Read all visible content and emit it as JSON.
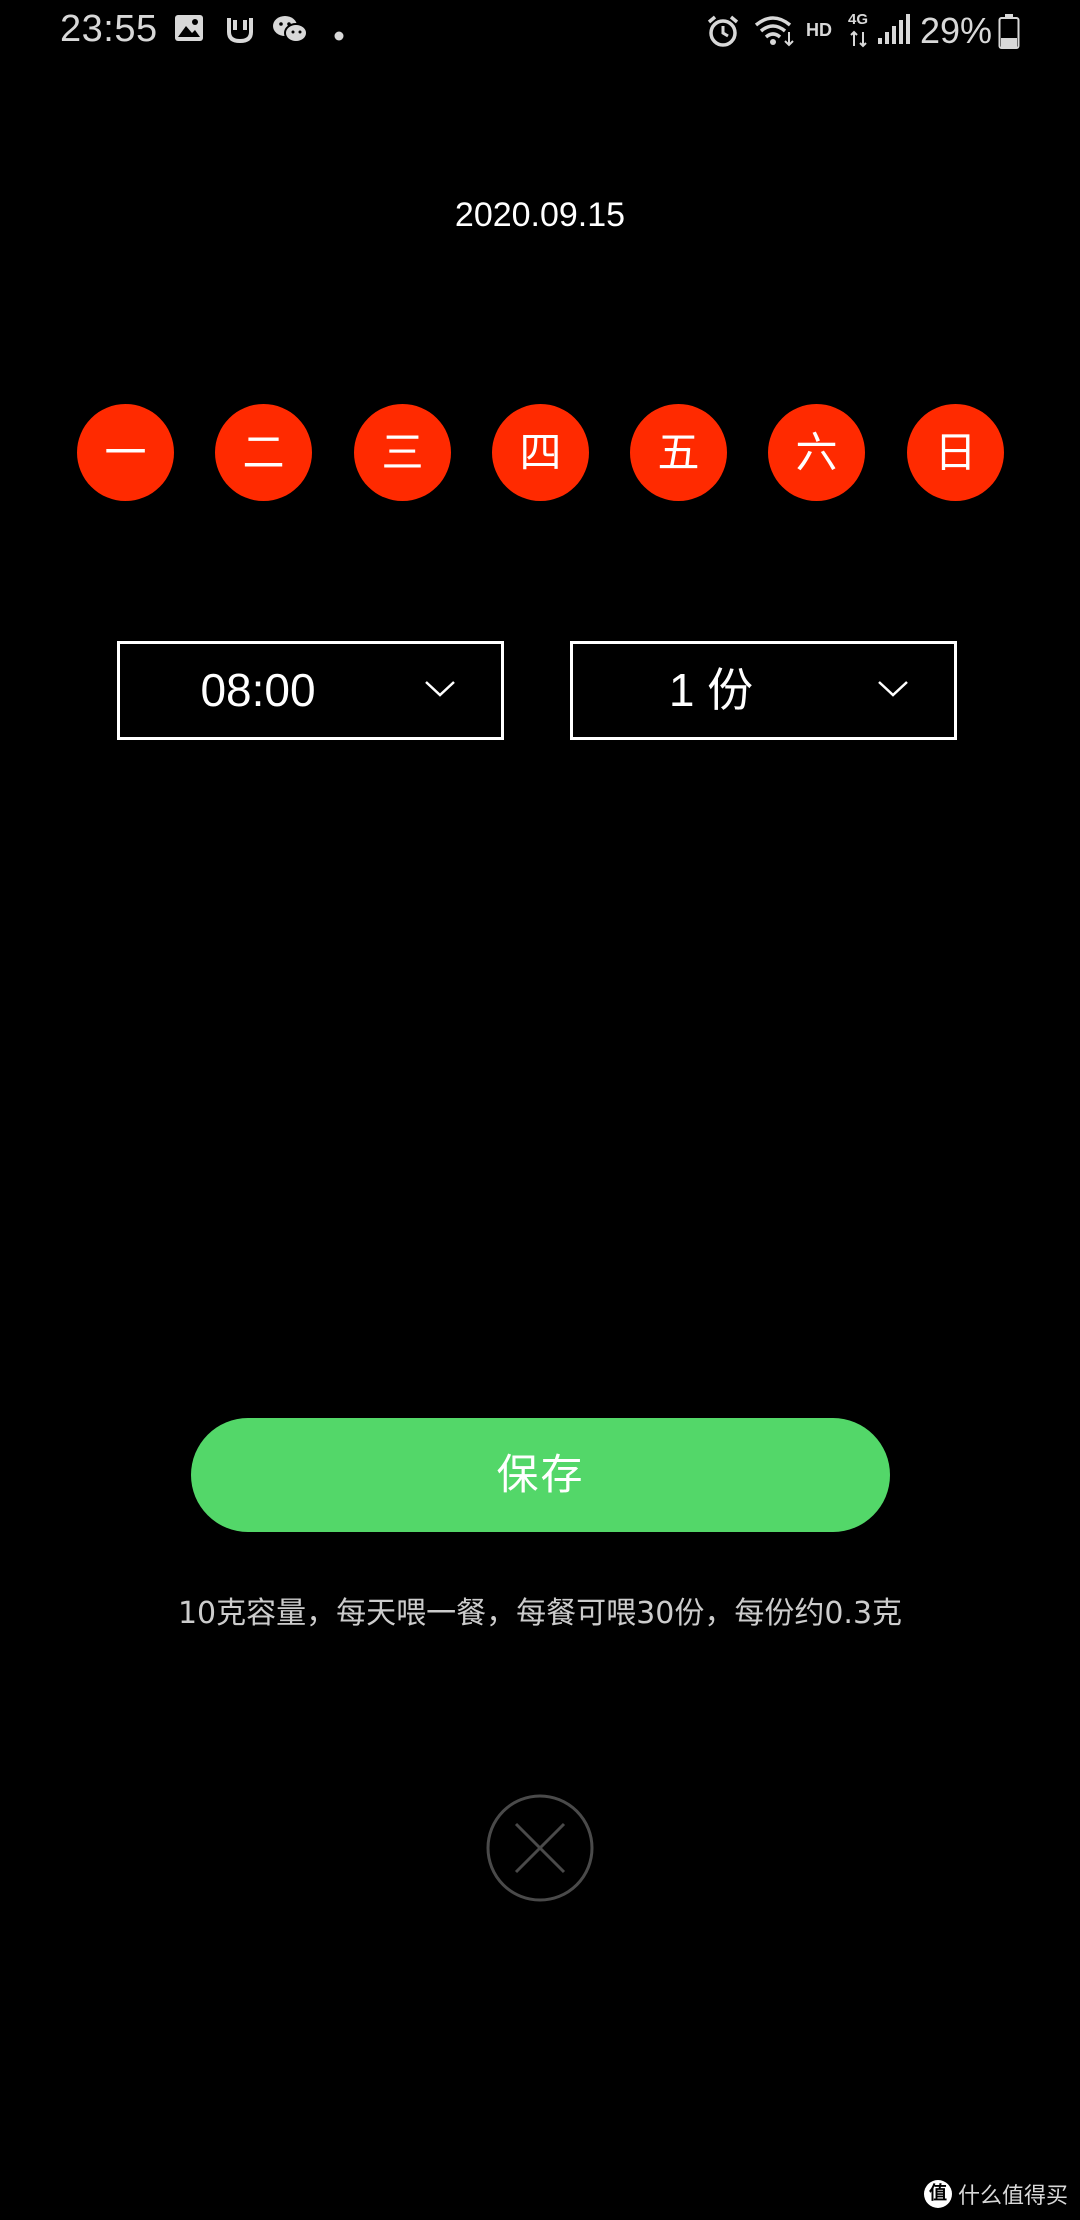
{
  "status_bar": {
    "time": "23:55",
    "network_hd": "HD",
    "network_type": "4G",
    "battery": "29%",
    "icons": [
      "image-icon",
      "mi-home-icon",
      "wechat-icon",
      "dot-icon",
      "alarm-icon",
      "wifi-icon",
      "signal-icon",
      "battery-icon"
    ]
  },
  "date": "2020.09.15",
  "weekdays": [
    "一",
    "二",
    "三",
    "四",
    "五",
    "六",
    "日"
  ],
  "weekday_color": "#ff2a00",
  "time_select": {
    "value": "08:00"
  },
  "portion_select": {
    "value": "1 份"
  },
  "save_button": {
    "label": "保存",
    "color": "#53d769"
  },
  "hint": "10克容量，每天喂一餐，每餐可喂30份，每份约0.3克",
  "close_icon": "close-icon",
  "watermark": {
    "text": "什么值得买",
    "logo": "值"
  }
}
